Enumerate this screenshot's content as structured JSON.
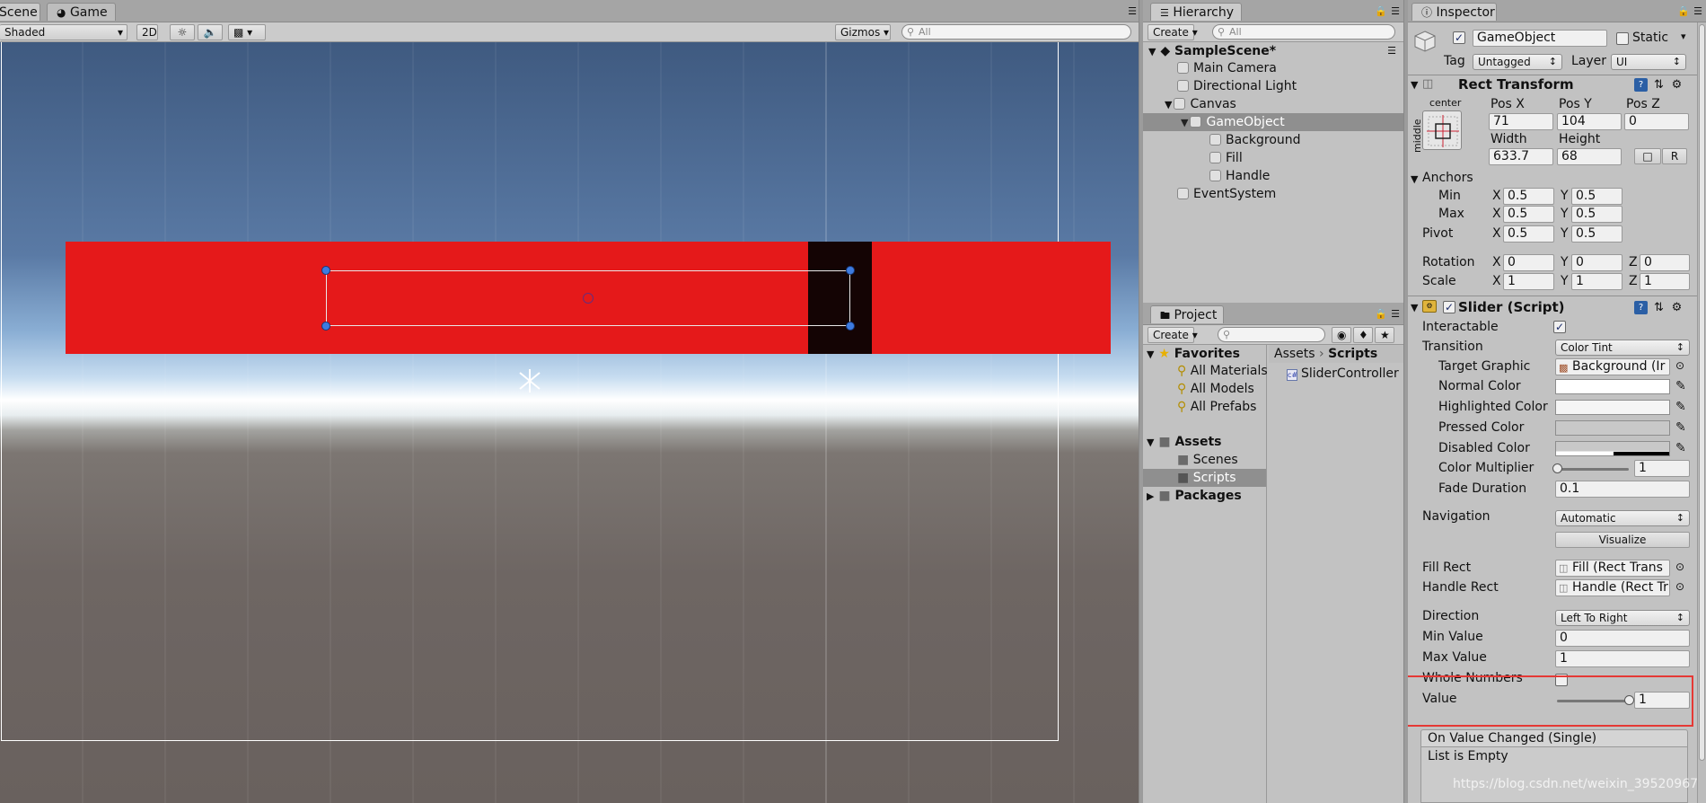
{
  "scene": {
    "tabs": [
      {
        "label": "Scene"
      },
      {
        "label": "Game"
      }
    ],
    "shading_mode": "Shaded",
    "mode_2d": "2D",
    "gizmos": "Gizmos",
    "search_placeholder": "All"
  },
  "hierarchy": {
    "tab": "Hierarchy",
    "create": "Create",
    "search_placeholder": "All",
    "scene_name": "SampleScene*",
    "items": [
      {
        "label": "Main Camera"
      },
      {
        "label": "Directional Light"
      },
      {
        "label": "Canvas"
      },
      {
        "label": "GameObject"
      },
      {
        "label": "Background"
      },
      {
        "label": "Fill"
      },
      {
        "label": "Handle"
      },
      {
        "label": "EventSystem"
      }
    ]
  },
  "project": {
    "tab": "Project",
    "create": "Create",
    "favorites_header": "Favorites",
    "favorites": [
      "All Materials",
      "All Models",
      "All Prefabs"
    ],
    "assets_header": "Assets",
    "assets": [
      "Scenes",
      "Scripts"
    ],
    "packages": "Packages",
    "breadcrumb": [
      "Assets",
      "Scripts"
    ],
    "files": [
      "SliderController"
    ]
  },
  "inspector": {
    "tab": "Inspector",
    "object_name": "GameObject",
    "static_label": "Static",
    "tag_label": "Tag",
    "tag_value": "Untagged",
    "layer_label": "Layer",
    "layer_value": "UI",
    "rect_transform": {
      "header": "Rect Transform",
      "anchor_h": "center",
      "anchor_v": "middle",
      "pos_x_label": "Pos X",
      "pos_y_label": "Pos Y",
      "pos_z_label": "Pos Z",
      "pos_x": "71",
      "pos_y": "104",
      "pos_z": "0",
      "width_label": "Width",
      "height_label": "Height",
      "width": "633.7",
      "height": "68",
      "r_button": "R",
      "anchors_label": "Anchors",
      "min_label": "Min",
      "max_label": "Max",
      "pivot_label": "Pivot",
      "x": "X",
      "y": "Y",
      "z": "Z",
      "min_x": "0.5",
      "min_y": "0.5",
      "max_x": "0.5",
      "max_y": "0.5",
      "pivot_x": "0.5",
      "pivot_y": "0.5",
      "rotation_label": "Rotation",
      "scale_label": "Scale",
      "rot_x": "0",
      "rot_y": "0",
      "rot_z": "0",
      "scale_x": "1",
      "scale_y": "1",
      "scale_z": "1"
    },
    "slider": {
      "header": "Slider (Script)",
      "interactable_label": "Interactable",
      "transition_label": "Transition",
      "transition_value": "Color Tint",
      "target_graphic_label": "Target Graphic",
      "target_graphic_value": "Background (Ir",
      "normal_color_label": "Normal Color",
      "highlighted_color_label": "Highlighted Color",
      "pressed_color_label": "Pressed Color",
      "disabled_color_label": "Disabled Color",
      "color_multiplier_label": "Color Multiplier",
      "color_multiplier_value": "1",
      "color_multiplier_fraction": 0.0,
      "fade_duration_label": "Fade Duration",
      "fade_duration_value": "0.1",
      "navigation_label": "Navigation",
      "navigation_value": "Automatic",
      "visualize": "Visualize",
      "fill_rect_label": "Fill Rect",
      "fill_rect_value": "Fill (Rect Trans",
      "handle_rect_label": "Handle Rect",
      "handle_rect_value": "Handle (Rect Tr",
      "direction_label": "Direction",
      "direction_value": "Left To Right",
      "min_value_label": "Min Value",
      "min_value": "0",
      "max_value_label": "Max Value",
      "max_value": "1",
      "whole_numbers_label": "Whole Numbers",
      "value_label": "Value",
      "value": "1",
      "value_fraction": 1.0,
      "event_header": "On Value Changed (Single)",
      "event_empty": "List is Empty"
    },
    "watermark": "https://blog.csdn.net/weixin_39520967"
  },
  "colors": {
    "slider_red": "#e5191a",
    "handle_dark": "#140404",
    "highlight_box": "#e53935",
    "selection": "#8f8f8f"
  }
}
